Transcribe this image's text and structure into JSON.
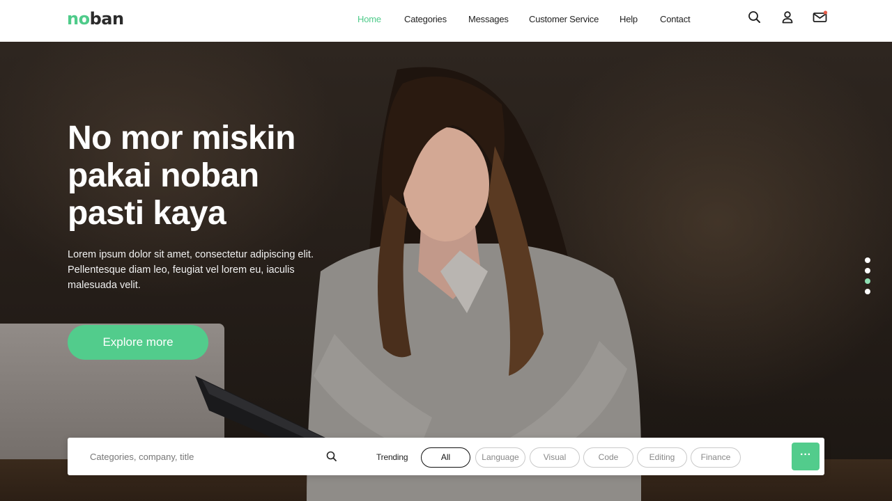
{
  "brand": {
    "logo_part1": "no",
    "logo_part2": "ban"
  },
  "nav": {
    "items": [
      {
        "label": "Home",
        "active": true
      },
      {
        "label": "Categories",
        "active": false
      },
      {
        "label": "Messages",
        "active": false
      },
      {
        "label": "Customer Service",
        "active": false
      },
      {
        "label": "Help",
        "active": false
      },
      {
        "label": "Contact",
        "active": false
      }
    ]
  },
  "header_icons": [
    "search-icon",
    "user-icon",
    "mail-icon"
  ],
  "hero": {
    "title_lines": [
      "No mor miskin",
      "pakai noban",
      "pasti kaya"
    ],
    "description": "Lorem ipsum dolor sit amet, consectetur adipiscing elit. Pellentesque diam leo, feugiat vel lorem eu, iaculis malesuada velit.",
    "cta_label": "Explore more"
  },
  "carousel": {
    "total": 4,
    "active_index": 2
  },
  "search": {
    "placeholder": "Categories, company, title",
    "value": "",
    "trending_label": "Trending",
    "filters": [
      {
        "label": "All",
        "active": true
      },
      {
        "label": "Language",
        "active": false
      },
      {
        "label": "Visual",
        "active": false
      },
      {
        "label": "Code",
        "active": false
      },
      {
        "label": "Editing",
        "active": false
      },
      {
        "label": "Finance",
        "active": false
      }
    ],
    "more_label": "···"
  },
  "colors": {
    "accent": "#52cc8c",
    "text_dark": "#1f1f1f",
    "notification": "#e85d4a"
  }
}
